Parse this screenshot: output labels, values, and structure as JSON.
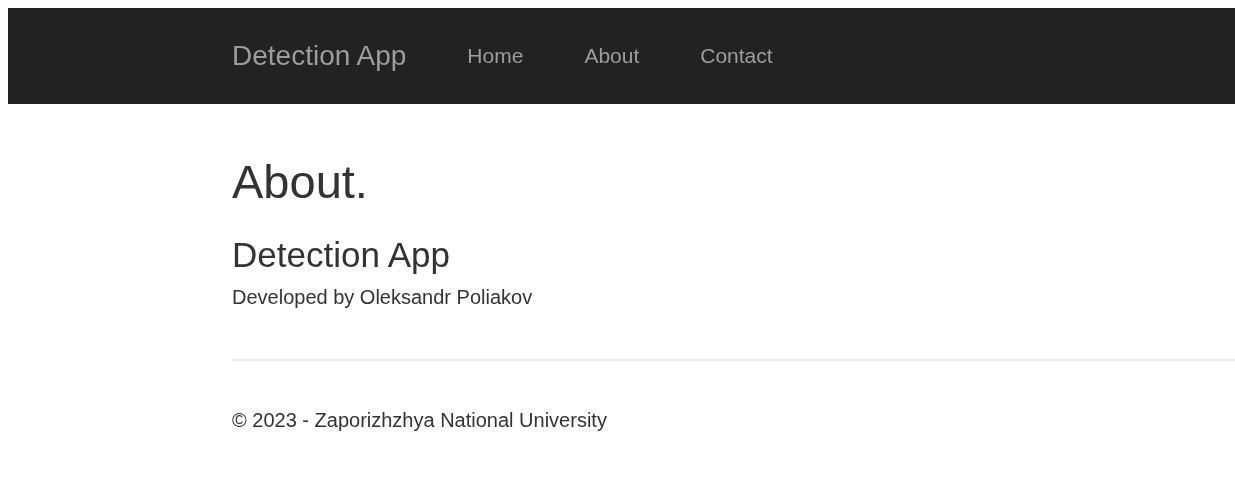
{
  "navbar": {
    "brand": "Detection App",
    "links": [
      "Home",
      "About",
      "Contact"
    ]
  },
  "page": {
    "title": "About.",
    "subtitle": "Detection App",
    "text": "Developed by Oleksandr Poliakov"
  },
  "footer": {
    "text": "© 2023 - Zaporizhzhya National University"
  }
}
